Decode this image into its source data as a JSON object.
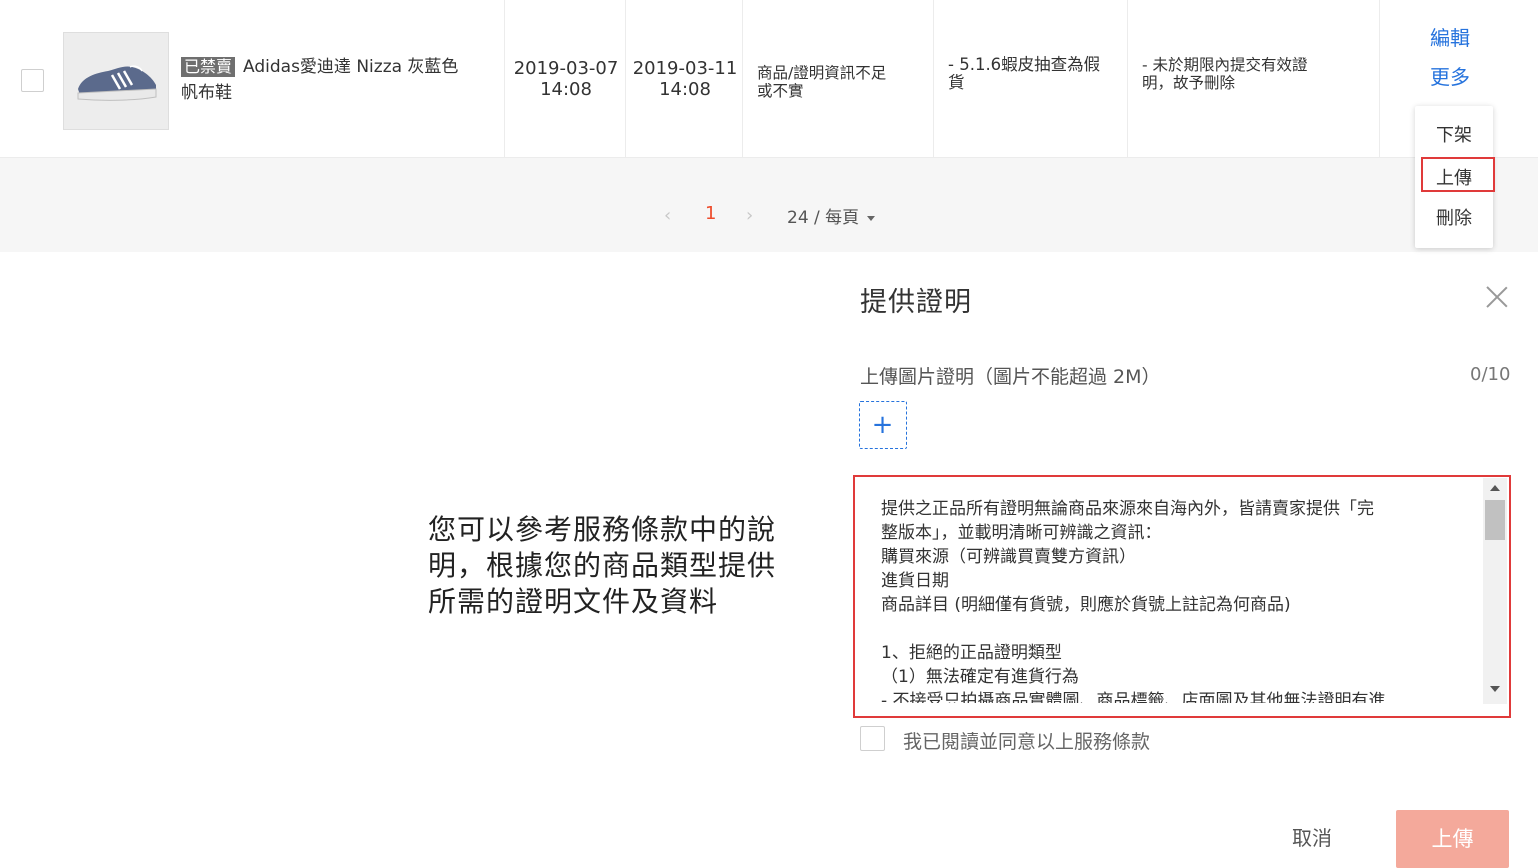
{
  "product_row": {
    "status_badge": "已禁賣",
    "name_line1": "Adidas愛迪達 Nizza 灰藍色",
    "name_line2": "帆布鞋",
    "created_date": "2019-03-07",
    "created_time": "14:08",
    "updated_date": "2019-03-11",
    "updated_time": "14:08",
    "reason_line1": "商品/證明資訊不足",
    "reason_line2": "或不實",
    "rule_line1": "- 5.1.6蝦皮抽查為假",
    "rule_line2": "貨",
    "result_line1": "- 未於期限內提交有效證",
    "result_line2": "明，故予刪除",
    "edit_link": "編輯",
    "more_link": "更多"
  },
  "more_menu": {
    "items": [
      "下架",
      "上傳",
      "刪除"
    ]
  },
  "pagination": {
    "prev": "‹",
    "current_page": "1",
    "next": "›",
    "page_size": "24 / 每頁"
  },
  "annotation": {
    "line1": "您可以參考服務條款中的說",
    "line2": "明，根據您的商品類型提供",
    "line3": "所需的證明文件及資料"
  },
  "modal": {
    "title": "提供證明",
    "upload_label": "上傳圖片證明（圖片不能超過 2M）",
    "upload_count": "0/10",
    "upload_plus": "+",
    "terms_lines": [
      "提供之正品所有證明無論商品來源來自海內外，皆請賣家提供「完",
      "整版本」，並載明清晰可辨識之資訊：",
      "購買來源（可辨識買賣雙方資訊）",
      "進貨日期",
      "商品詳目 (明細僅有貨號，則應於貨號上註記為何商品)",
      "",
      "1、拒絕的正品證明類型",
      "（1）無法確定有進貨行為",
      "- 不接受只拍攝商品實體圖、商品標籤、店面圖及其他無法證明有進"
    ],
    "agree_text": "我已閱讀並同意以上服務條款",
    "cancel_label": "取消",
    "submit_label": "上傳"
  }
}
